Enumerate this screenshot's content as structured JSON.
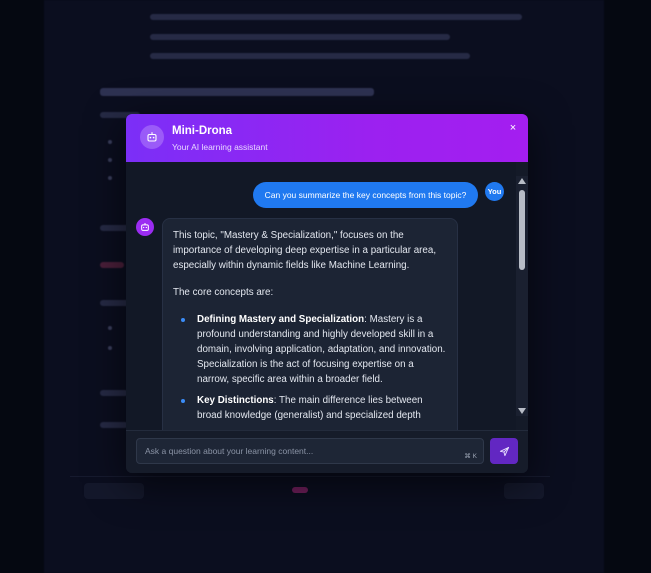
{
  "app": {
    "title": "Mini-Drona",
    "subtitle": "Your AI learning assistant"
  },
  "close_icon_glyph": "×",
  "messages": {
    "user": {
      "avatar_label": "You",
      "text": "Can you summarize the key concepts from this topic?"
    },
    "assistant": {
      "intro": "This topic, \"Mastery & Specialization,\" focuses on the importance of developing deep expertise in a particular area, especially within dynamic fields like Machine Learning.",
      "lead": "The core concepts are:",
      "items": [
        {
          "title": "Defining Mastery and Specialization",
          "text": ": Mastery is a profound understanding and highly developed skill in a domain, involving application, adaptation, and innovation. Specialization is the act of focusing expertise on a narrow, specific area within a broader field."
        },
        {
          "title": "Key Distinctions",
          "text": ": The main difference lies between broad knowledge (generalist) and specialized depth"
        }
      ]
    }
  },
  "input": {
    "placeholder": "Ask a question about your learning content...",
    "value": "",
    "shortcut": "⌘ K"
  },
  "colors": {
    "header_gradient_start": "#7b2ff7",
    "header_gradient_end": "#a41ef0",
    "user_bubble": "#2079f0",
    "send_button": "#6227c2",
    "bullet": "#3b8cf7"
  },
  "icons": {
    "header": "robot-icon",
    "assistant": "robot-icon",
    "close": "close-icon",
    "send": "send-icon"
  }
}
